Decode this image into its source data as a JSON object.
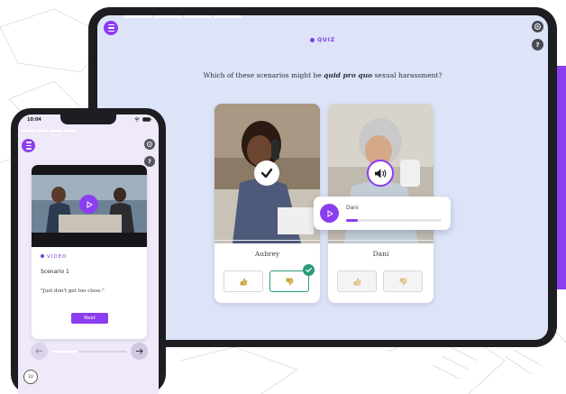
{
  "tablet": {
    "quiz_label": "QUIZ",
    "question_before": "Which of these scenarios might be ",
    "question_emphasis": "quid pro quo",
    "question_after": " sexual harassment?",
    "help_label": "?",
    "cards": [
      {
        "name": "Aubrey",
        "state": "checked"
      },
      {
        "name": "Dani",
        "state": "audio-playing"
      }
    ],
    "audio_popup": {
      "label": "Dani",
      "progress": 0.12
    }
  },
  "phone": {
    "time": "10:04",
    "help_label": "?",
    "video_label": "VIDEO",
    "scenario_title": "Scenario 1",
    "quote": "\"Just don't get too close.\"",
    "next_label": "Next",
    "nav_progress": 0.35,
    "timer_label": "10"
  },
  "colors": {
    "accent": "#8b3df0",
    "success": "#2b9b7b",
    "tablet_bg": "#dde4f8",
    "phone_bg": "#efe9f9"
  },
  "icons": [
    "menu-icon",
    "settings-icon",
    "help-icon",
    "check-icon",
    "speaker-icon",
    "play-icon",
    "thumbs-up-icon",
    "thumbs-down-icon",
    "arrow-left-icon",
    "arrow-right-icon",
    "timer-icon",
    "wifi-icon",
    "battery-icon"
  ]
}
